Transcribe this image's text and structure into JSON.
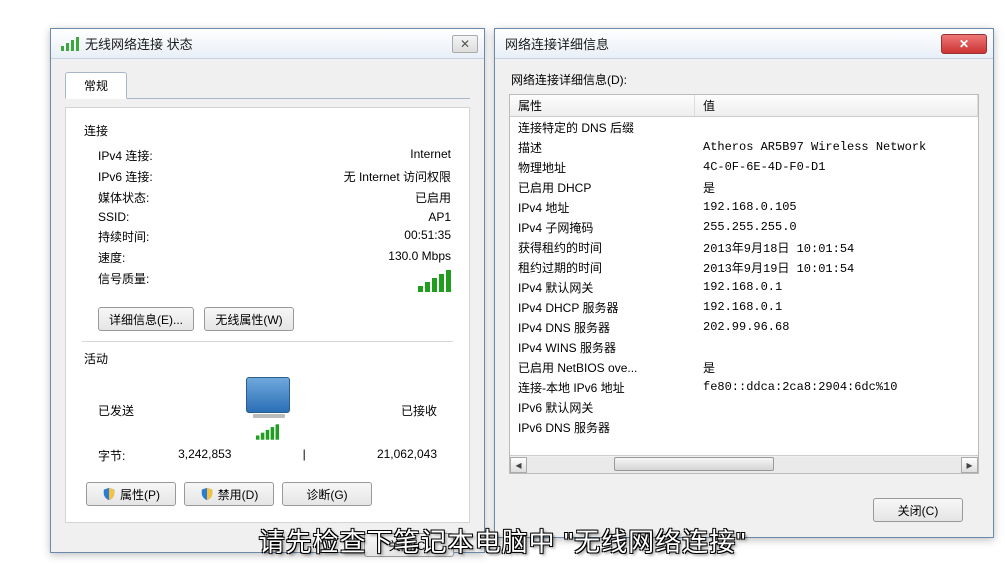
{
  "left": {
    "title": "无线网络连接 状态",
    "tab": "常规",
    "section_conn": "连接",
    "rows": {
      "ipv4_k": "IPv4 连接:",
      "ipv4_v": "Internet",
      "ipv6_k": "IPv6 连接:",
      "ipv6_v": "无 Internet 访问权限",
      "media_k": "媒体状态:",
      "media_v": "已启用",
      "ssid_k": "SSID:",
      "ssid_v": "AP1",
      "dur_k": "持续时间:",
      "dur_v": "00:51:35",
      "speed_k": "速度:",
      "speed_v": "130.0 Mbps",
      "signal_k": "信号质量:"
    },
    "btn_details": "详细信息(E)...",
    "btn_wireless": "无线属性(W)",
    "section_act": "活动",
    "sent_label": "已发送",
    "recv_label": "已接收",
    "bytes_k": "字节:",
    "bytes_sent": "3,242,853",
    "bytes_recv": "21,062,043",
    "btn_props": "属性(P)",
    "btn_disable": "禁用(D)",
    "btn_diag": "诊断(G)",
    "btn_close": "关闭(C)"
  },
  "right": {
    "title": "网络连接详细信息",
    "subtitle": "网络连接详细信息(D):",
    "col_prop": "属性",
    "col_val": "值",
    "rows": [
      {
        "p": "连接特定的 DNS 后缀",
        "v": ""
      },
      {
        "p": "描述",
        "v": "Atheros AR5B97 Wireless Network"
      },
      {
        "p": "物理地址",
        "v": "4C-0F-6E-4D-F0-D1"
      },
      {
        "p": "已启用 DHCP",
        "v": "是"
      },
      {
        "p": "IPv4 地址",
        "v": "192.168.0.105"
      },
      {
        "p": "IPv4 子网掩码",
        "v": "255.255.255.0"
      },
      {
        "p": "获得租约的时间",
        "v": "2013年9月18日 10:01:54"
      },
      {
        "p": "租约过期的时间",
        "v": "2013年9月19日 10:01:54"
      },
      {
        "p": "IPv4 默认网关",
        "v": "192.168.0.1"
      },
      {
        "p": "IPv4 DHCP 服务器",
        "v": "192.168.0.1"
      },
      {
        "p": "IPv4 DNS 服务器",
        "v": "202.99.96.68"
      },
      {
        "p": "IPv4 WINS 服务器",
        "v": ""
      },
      {
        "p": "已启用 NetBIOS ove...",
        "v": "是"
      },
      {
        "p": "连接-本地 IPv6 地址",
        "v": "fe80::ddca:2ca8:2904:6dc%10"
      },
      {
        "p": "IPv6 默认网关",
        "v": ""
      },
      {
        "p": "IPv6 DNS 服务器",
        "v": ""
      }
    ],
    "btn_close": "关闭(C)"
  },
  "caption": "请先检查下笔记本电脑中 \"无线网络连接\""
}
